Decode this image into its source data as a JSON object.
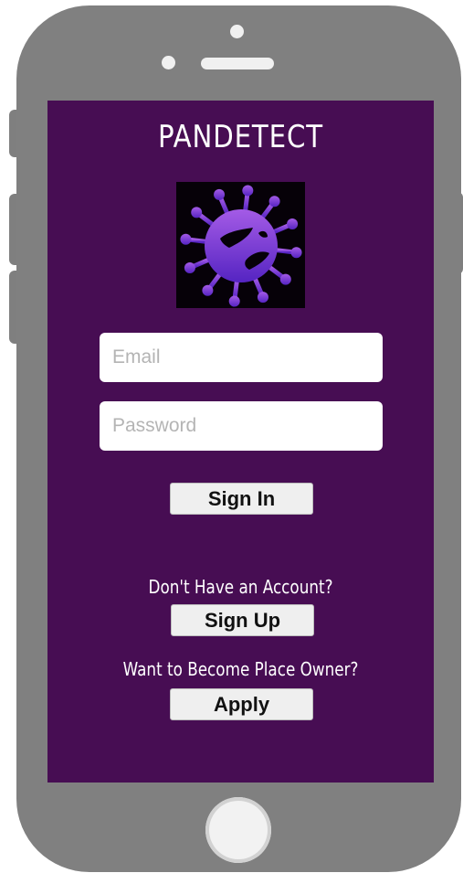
{
  "app": {
    "title": "PANDETECT"
  },
  "login": {
    "email_placeholder": "Email",
    "password_placeholder": "Password",
    "sign_in_label": "Sign In"
  },
  "signup": {
    "prompt": "Don't Have an Account?",
    "button_label": "Sign Up"
  },
  "owner": {
    "prompt": "Want to Become Place Owner?",
    "button_label": "Apply"
  },
  "logo": {
    "icon": "virus-icon"
  },
  "colors": {
    "screen_background": "#470d53",
    "phone_body": "#808080",
    "logo_gradient_top": "#9a4ee0",
    "logo_gradient_bottom": "#5a22c4",
    "button_background": "#efefef"
  }
}
